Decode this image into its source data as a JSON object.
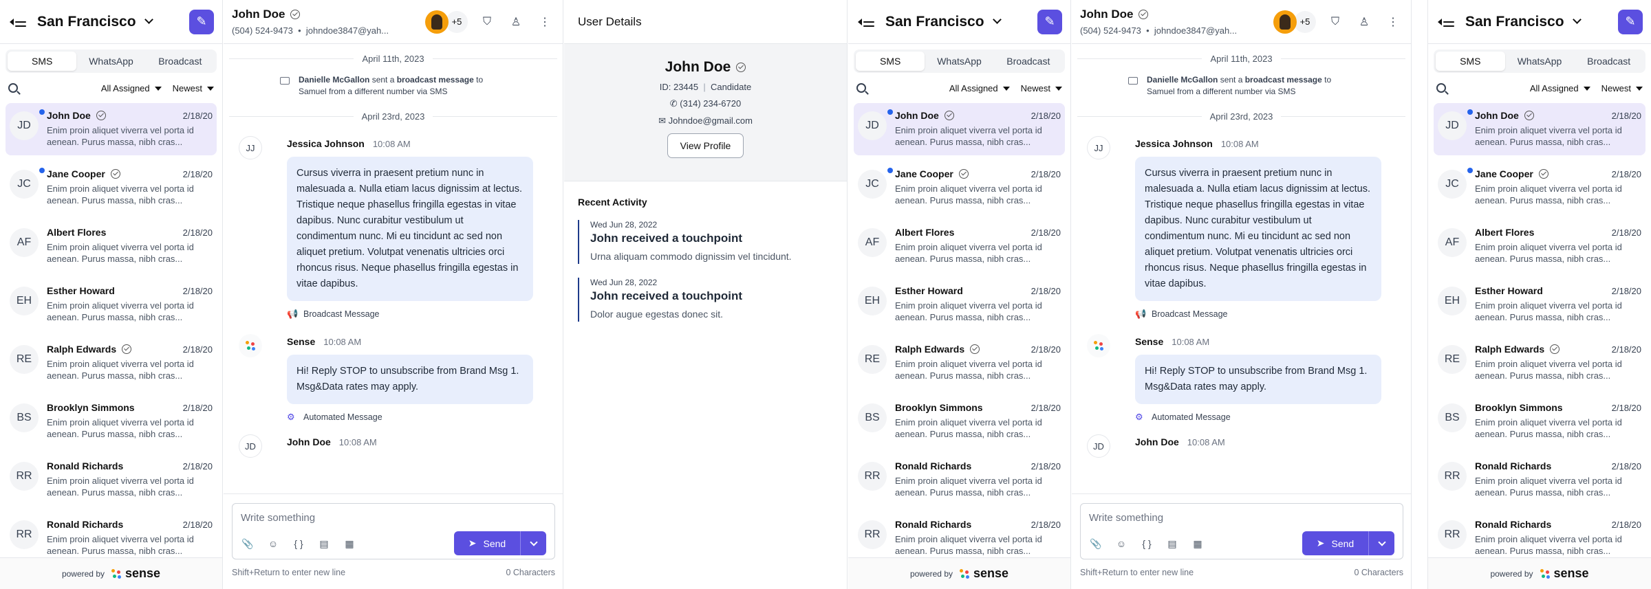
{
  "list": {
    "location": "San Francisco",
    "tabs": [
      "SMS",
      "WhatsApp",
      "Broadcast"
    ],
    "filter_assigned": "All Assigned",
    "filter_sort": "Newest",
    "conversations": [
      {
        "initials": "JD",
        "name": "John Doe",
        "verified": true,
        "unread": true,
        "date": "2/18/20",
        "preview": "Enim proin aliquet viverra vel porta id aenean. Purus massa, nibh cras..."
      },
      {
        "initials": "JC",
        "name": "Jane Cooper",
        "verified": true,
        "unread": true,
        "date": "2/18/20",
        "preview": "Enim proin aliquet viverra vel porta id aenean. Purus massa, nibh cras..."
      },
      {
        "initials": "AF",
        "name": "Albert Flores",
        "verified": false,
        "unread": false,
        "date": "2/18/20",
        "preview": "Enim proin aliquet viverra vel porta id aenean. Purus massa, nibh cras..."
      },
      {
        "initials": "EH",
        "name": "Esther Howard",
        "verified": false,
        "unread": false,
        "date": "2/18/20",
        "preview": "Enim proin aliquet viverra vel porta id aenean. Purus massa, nibh cras..."
      },
      {
        "initials": "RE",
        "name": "Ralph Edwards",
        "verified": true,
        "unread": false,
        "date": "2/18/20",
        "preview": "Enim proin aliquet viverra vel porta id aenean. Purus massa, nibh cras..."
      },
      {
        "initials": "BS",
        "name": "Brooklyn Simmons",
        "verified": false,
        "unread": false,
        "date": "2/18/20",
        "preview": "Enim proin aliquet viverra vel porta id aenean. Purus massa, nibh cras..."
      },
      {
        "initials": "RR",
        "name": "Ronald Richards",
        "verified": false,
        "unread": false,
        "date": "2/18/20",
        "preview": "Enim proin aliquet viverra vel porta id aenean. Purus massa, nibh cras..."
      },
      {
        "initials": "RR",
        "name": "Ronald Richards",
        "verified": false,
        "unread": false,
        "date": "2/18/20",
        "preview": "Enim proin aliquet viverra vel porta id aenean. Purus massa, nibh cras..."
      }
    ],
    "powered_by": "powered by",
    "brand": "sense"
  },
  "chat": {
    "contact_name": "John Doe",
    "phone": "(504) 524-9473",
    "email": "johndoe3847@yah...",
    "participants_extra": "+5",
    "date1": "April 11th, 2023",
    "event_actor": "Danielle McGallon",
    "event_text1": " sent a ",
    "event_bold": "broadcast message",
    "event_text2": " to Samuel from a different number via SMS",
    "date2": "April 23rd, 2023",
    "msg1_initials": "JJ",
    "msg1_sender": "Jessica Johnson",
    "msg1_time": "10:08 AM",
    "msg1_text": "Cursus viverra in praesent pretium nunc in malesuada a. Nulla etiam lacus dignissim at lectus. Tristique neque phasellus fringilla egestas in vitae dapibus. Nunc curabitur vestibulum ut condimentum nunc. Mi eu tincidunt ac sed non aliquet pretium. Volutpat venenatis ultricies orci rhoncus risus. Neque phasellus fringilla egestas in vitae dapibus.",
    "msg1_footer": "Broadcast Message",
    "msg2_sender": "Sense",
    "msg2_time": "10:08 AM",
    "msg2_text": "Hi! Reply STOP to unsubscribe from Brand Msg 1. Msg&Data rates may apply.",
    "msg2_footer": "Automated Message",
    "msg3_initials": "JD",
    "msg3_sender": "John Doe",
    "msg3_time": "10:08 AM",
    "composer_placeholder": "Write something",
    "send_label": "Send",
    "hint": "Shift+Return to enter new line",
    "char_count": "0 Characters"
  },
  "details": {
    "title": "User Details",
    "name": "John Doe",
    "id": "ID: 23445",
    "role": "Candidate",
    "phone": "(314) 234-6720",
    "email": "Johndoe@gmail.com",
    "view_profile": "View Profile",
    "recent_title": "Recent Activity",
    "activities": [
      {
        "date": "Wed Jun 28, 2022",
        "title": "John received a touchpoint",
        "text": "Urna aliquam commodo dignissim vel tincidunt."
      },
      {
        "date": "Wed Jun 28, 2022",
        "title": "John received a touchpoint",
        "text": "Dolor augue egestas donec sit."
      }
    ]
  },
  "colors": {
    "accent": "#5b4fe0",
    "selected_row": "#ece9fb",
    "bubble": "#e8eefc",
    "unread_dot": "#2563eb"
  }
}
